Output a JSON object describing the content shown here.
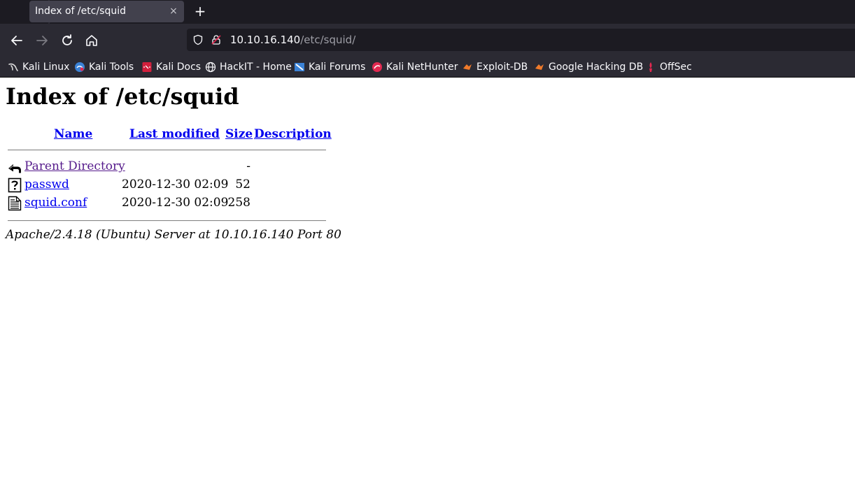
{
  "browser": {
    "tab_title": "Index of /etc/squid",
    "close_glyph": "×",
    "new_tab_glyph": "+",
    "url_host": "10.10.16.140",
    "url_path": "/etc/squid/",
    "bookmarks": [
      {
        "label": "Kali Linux",
        "icon": "kali-dragon-icon"
      },
      {
        "label": "Kali Tools",
        "icon": "kali-tools-icon"
      },
      {
        "label": "Kali Docs",
        "icon": "kali-docs-icon"
      },
      {
        "label": "HackIT - Home",
        "icon": "globe-icon"
      },
      {
        "label": "Kali Forums",
        "icon": "kali-forums-icon"
      },
      {
        "label": "Kali NetHunter",
        "icon": "nethunter-icon"
      },
      {
        "label": "Exploit-DB",
        "icon": "exploit-db-icon"
      },
      {
        "label": "Google Hacking DB",
        "icon": "ghdb-icon"
      },
      {
        "label": "OffSec",
        "icon": "offsec-icon"
      }
    ]
  },
  "page": {
    "title": "Index of /etc/squid",
    "columns": {
      "name": "Name",
      "last_modified": "Last modified",
      "size": "Size",
      "description": "Description"
    },
    "rows": [
      {
        "name": "Parent Directory",
        "date": "",
        "size": "-",
        "icon": "back-arrow-icon",
        "visited": true
      },
      {
        "name": "passwd",
        "date": "2020-12-30 02:09",
        "size": "52",
        "icon": "unknown-file-icon",
        "visited": false
      },
      {
        "name": "squid.conf",
        "date": "2020-12-30 02:09",
        "size": "258",
        "icon": "text-file-icon",
        "visited": false
      }
    ],
    "footer": "Apache/2.4.18 (Ubuntu) Server at 10.10.16.140 Port 80"
  },
  "colors": {
    "link": "#0000ee",
    "visited_link": "#551a8b",
    "chrome_dark": "#1c1b22",
    "chrome": "#2b2a33"
  }
}
